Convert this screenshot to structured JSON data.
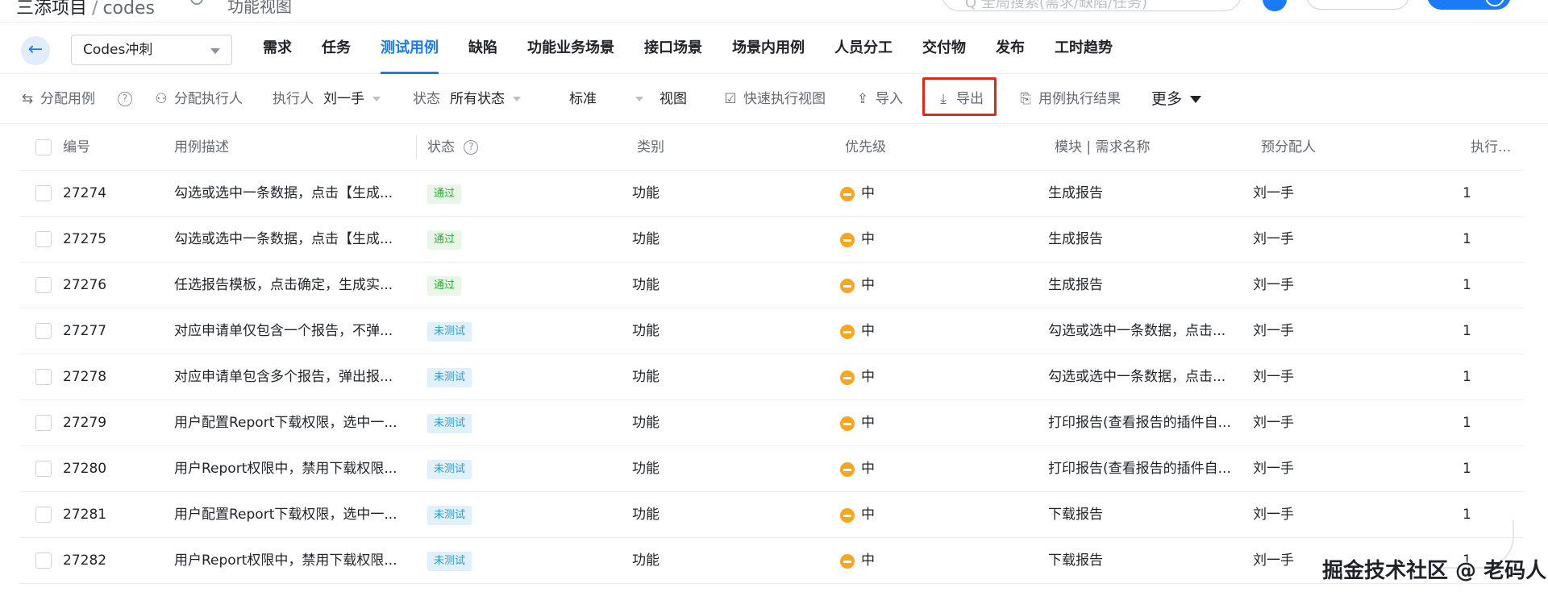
{
  "top": {
    "crumb_project": "三添项目",
    "crumb_sep": "/",
    "crumb_name": "codes",
    "view_label": "功能视图",
    "search_placeholder": "Q 全局搜索(需求/缺陷/任务)"
  },
  "nav": {
    "back_label": "←",
    "sprint": "Codes冲刺",
    "tabs": [
      "需求",
      "任务",
      "测试用例",
      "缺陷",
      "功能业务场景",
      "接口场景",
      "场景内用例",
      "人员分工",
      "交付物",
      "发布",
      "工时趋势"
    ],
    "active_tab": "测试用例"
  },
  "toolbar": {
    "assign_case": "分配用例",
    "help": "?",
    "assign_executor": "分配执行人",
    "executor_label": "执行人",
    "executor_value": "刘一手",
    "status_label": "状态",
    "status_value": "所有状态",
    "mode_value": "标准",
    "view_label": "视图",
    "quick_view": "快速执行视图",
    "import": "导入",
    "export": "导出",
    "results": "用例执行结果",
    "more": "更多"
  },
  "table": {
    "headers": {
      "id": "编号",
      "desc": "用例描述",
      "status": "状态",
      "category": "类别",
      "priority": "优先级",
      "module": "模块 | 需求名称",
      "assignee": "预分配人",
      "exec": "执行..."
    },
    "rows": [
      {
        "id": "27274",
        "desc": "勾选或选中一条数据，点击【生成...",
        "status": "通过",
        "status_type": "pass",
        "category": "功能",
        "priority": "中",
        "module": "生成报告",
        "assignee": "刘一手",
        "exec": "1"
      },
      {
        "id": "27275",
        "desc": "勾选或选中一条数据，点击【生成...",
        "status": "通过",
        "status_type": "pass",
        "category": "功能",
        "priority": "中",
        "module": "生成报告",
        "assignee": "刘一手",
        "exec": "1"
      },
      {
        "id": "27276",
        "desc": "任选报告模板，点击确定，生成实...",
        "status": "通过",
        "status_type": "pass",
        "category": "功能",
        "priority": "中",
        "module": "生成报告",
        "assignee": "刘一手",
        "exec": "1"
      },
      {
        "id": "27277",
        "desc": "对应申请单仅包含一个报告，不弹...",
        "status": "未测试",
        "status_type": "untested",
        "category": "功能",
        "priority": "中",
        "module": "勾选或选中一条数据，点击...",
        "assignee": "刘一手",
        "exec": "1"
      },
      {
        "id": "27278",
        "desc": "对应申请单包含多个报告，弹出报...",
        "status": "未测试",
        "status_type": "untested",
        "category": "功能",
        "priority": "中",
        "module": "勾选或选中一条数据，点击...",
        "assignee": "刘一手",
        "exec": "1"
      },
      {
        "id": "27279",
        "desc": "用户配置Report下载权限，选中一...",
        "status": "未测试",
        "status_type": "untested",
        "category": "功能",
        "priority": "中",
        "module": "打印报告(查看报告的插件自...",
        "assignee": "刘一手",
        "exec": "1"
      },
      {
        "id": "27280",
        "desc": "用户Report权限中，禁用下载权限...",
        "status": "未测试",
        "status_type": "untested",
        "category": "功能",
        "priority": "中",
        "module": "打印报告(查看报告的插件自...",
        "assignee": "刘一手",
        "exec": "1"
      },
      {
        "id": "27281",
        "desc": "用户配置Report下载权限，选中一...",
        "status": "未测试",
        "status_type": "untested",
        "category": "功能",
        "priority": "中",
        "module": "下载报告",
        "assignee": "刘一手",
        "exec": "1"
      },
      {
        "id": "27282",
        "desc": "用户Report权限中，禁用下载权限...",
        "status": "未测试",
        "status_type": "untested",
        "category": "功能",
        "priority": "中",
        "module": "下载报告",
        "assignee": "刘一手",
        "exec": "1"
      }
    ]
  },
  "watermark": "掘金技术社区 @ 老码人",
  "colors": {
    "accent": "#1a7af8",
    "highlight": "#e0271a",
    "priority_medium": "#f5a623",
    "pass_bg": "#e8f7e8",
    "untested_bg": "#e0f1fb"
  },
  "icons": {
    "assign_case": "swap-arrows-icon",
    "assign_executor": "user-plus-icon",
    "quick_view": "checkbox-icon",
    "import": "upload-icon",
    "export": "download-icon",
    "results": "document-icon"
  }
}
